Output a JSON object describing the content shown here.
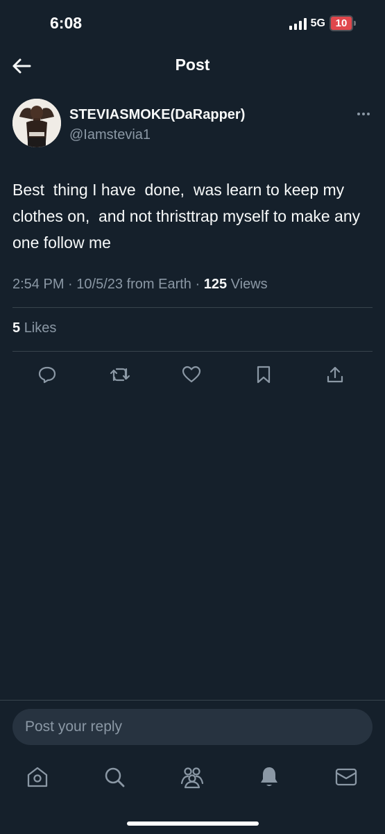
{
  "status_bar": {
    "time": "6:08",
    "network": "5G",
    "battery": "10",
    "battery_color": "#e0474c"
  },
  "header": {
    "title": "Post",
    "back_icon": "arrow-left-icon"
  },
  "post": {
    "author": {
      "display_name": "STEVIASMOKE(DaRapper)",
      "handle": "@Iamstevia1"
    },
    "text": "Best  thing I have  done,  was learn to keep my clothes on,  and not thristtrap myself to make any one follow me",
    "meta": {
      "time": "2:54 PM",
      "date": "10/5/23",
      "source": "from Earth",
      "views_count": "125",
      "views_label": "Views"
    },
    "likes": {
      "count": "5",
      "label": "Likes"
    },
    "actions": [
      "reply-icon",
      "repost-icon",
      "like-icon",
      "bookmark-icon",
      "share-icon"
    ]
  },
  "reply": {
    "placeholder": "Post your reply"
  },
  "tabbar": {
    "items": [
      "home-icon",
      "search-icon",
      "communities-icon",
      "notifications-icon",
      "messages-icon"
    ]
  },
  "colors": {
    "background": "#15202b",
    "text_primary": "#f7f9f9",
    "text_secondary": "#8b98a5",
    "divider": "#38444d"
  }
}
